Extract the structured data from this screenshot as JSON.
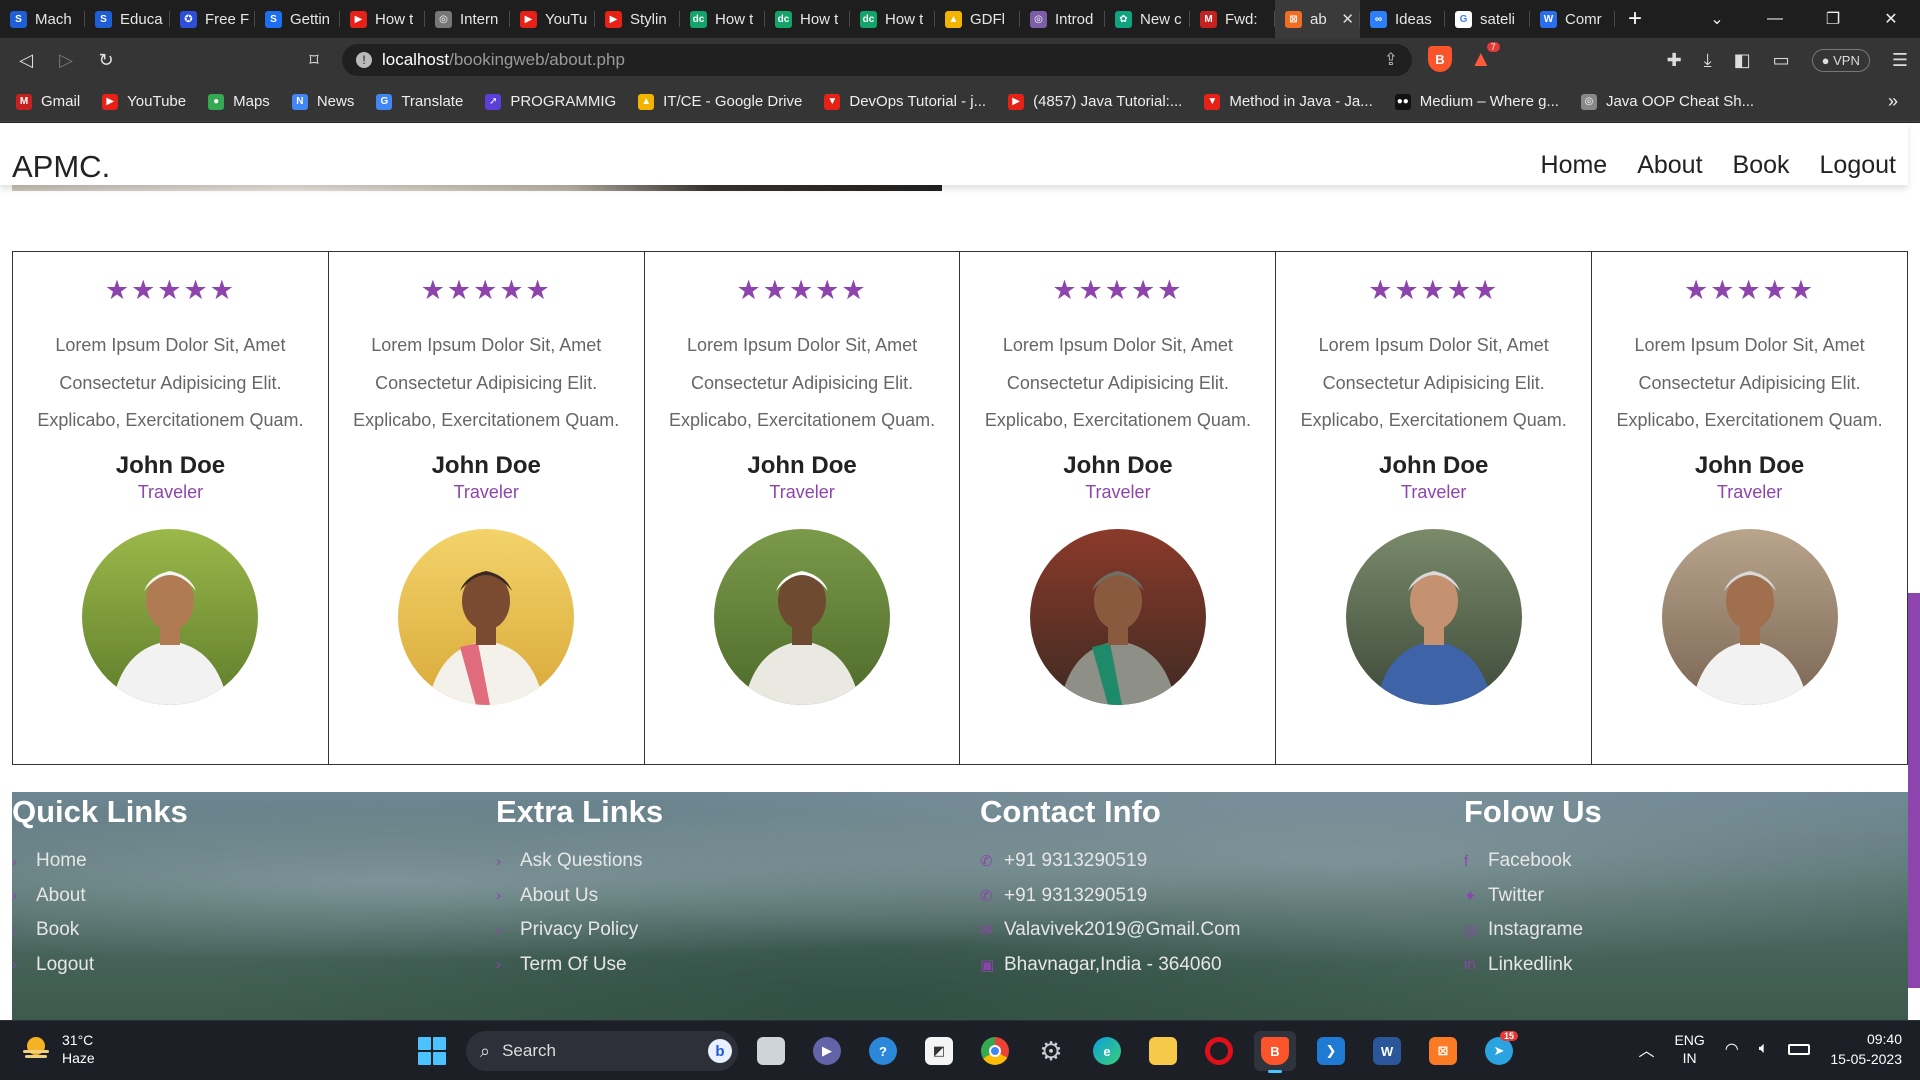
{
  "browser": {
    "tabs": [
      {
        "title": "Mach",
        "color": "#1f5fd6",
        "glyph": "S"
      },
      {
        "title": "Educa",
        "color": "#1f5fd6",
        "glyph": "S"
      },
      {
        "title": "Free F",
        "color": "#2b4fd9",
        "glyph": "✪"
      },
      {
        "title": "Gettin",
        "color": "#1e6ff0",
        "glyph": "S"
      },
      {
        "title": "How t",
        "color": "#e62117",
        "glyph": "▶"
      },
      {
        "title": "Intern",
        "color": "#777777",
        "glyph": "◎"
      },
      {
        "title": "YouTu",
        "color": "#e62117",
        "glyph": "▶"
      },
      {
        "title": "Stylin",
        "color": "#e62117",
        "glyph": "▶"
      },
      {
        "title": "How t",
        "color": "#13a36b",
        "glyph": "dc"
      },
      {
        "title": "How t",
        "color": "#13a36b",
        "glyph": "dc"
      },
      {
        "title": "How t",
        "color": "#13a36b",
        "glyph": "dc"
      },
      {
        "title": "GDFl",
        "color": "#f3b400",
        "glyph": "▲"
      },
      {
        "title": "Introd",
        "color": "#7b5ea7",
        "glyph": "◎"
      },
      {
        "title": "New c",
        "color": "#10a37f",
        "glyph": "✿"
      },
      {
        "title": "Fwd: ",
        "color": "#c5221f",
        "glyph": "M"
      },
      {
        "title": "ab",
        "color": "#f06d21",
        "glyph": "⊠",
        "active": true
      },
      {
        "title": "Ideas",
        "color": "#2d7ff9",
        "glyph": "∞"
      },
      {
        "title": "sateli",
        "color": "#ffffff",
        "glyph": "G"
      },
      {
        "title": "Comr",
        "color": "#2a6ef0",
        "glyph": "W"
      }
    ],
    "new_tab": "+",
    "url_host": "localhost",
    "url_path": "/bookingweb/about.php",
    "vpn_label": "VPN",
    "brave_badge": "7",
    "bookmarks": [
      {
        "label": "Gmail",
        "color": "#c5221f",
        "glyph": "M"
      },
      {
        "label": "YouTube",
        "color": "#e62117",
        "glyph": "▶"
      },
      {
        "label": "Maps",
        "color": "#34a853",
        "glyph": "●"
      },
      {
        "label": "News",
        "color": "#4285f4",
        "glyph": "N"
      },
      {
        "label": "Translate",
        "color": "#4285f4",
        "glyph": "G"
      },
      {
        "label": "PROGRAMMIG",
        "color": "#5b3fd8",
        "glyph": "➚"
      },
      {
        "label": "IT/CE - Google Drive",
        "color": "#f3b400",
        "glyph": "▲"
      },
      {
        "label": "DevOps Tutorial - j...",
        "color": "#e62117",
        "glyph": "▼"
      },
      {
        "label": "(4857) Java Tutorial:...",
        "color": "#e62117",
        "glyph": "▶"
      },
      {
        "label": "Method in Java - Ja...",
        "color": "#e62117",
        "glyph": "▼"
      },
      {
        "label": "Medium – Where g...",
        "color": "#111111",
        "glyph": "●●"
      },
      {
        "label": "Java OOP Cheat Sh...",
        "color": "#888888",
        "glyph": "◎"
      }
    ],
    "bookmarks_more": "»"
  },
  "site": {
    "logo": "APMC.",
    "nav": [
      "Home",
      "About",
      "Book",
      "Logout"
    ]
  },
  "reviews": [
    {
      "stars": "★★★★★",
      "text": "Lorem Ipsum Dolor Sit, Amet Consectetur Adipisicing Elit. Explicabo, Exercitationem Quam.",
      "name": "John Doe",
      "role": "Traveler"
    },
    {
      "stars": "★★★★★",
      "text": "Lorem Ipsum Dolor Sit, Amet Consectetur Adipisicing Elit. Explicabo, Exercitationem Quam.",
      "name": "John Doe",
      "role": "Traveler"
    },
    {
      "stars": "★★★★★",
      "text": "Lorem Ipsum Dolor Sit, Amet Consectetur Adipisicing Elit. Explicabo, Exercitationem Quam.",
      "name": "John Doe",
      "role": "Traveler"
    },
    {
      "stars": "★★★★★",
      "text": "Lorem Ipsum Dolor Sit, Amet Consectetur Adipisicing Elit. Explicabo, Exercitationem Quam.",
      "name": "John Doe",
      "role": "Traveler"
    },
    {
      "stars": "★★★★★",
      "text": "Lorem Ipsum Dolor Sit, Amet Consectetur Adipisicing Elit. Explicabo, Exercitationem Quam.",
      "name": "John Doe",
      "role": "Traveler"
    },
    {
      "stars": "★★★★★",
      "text": "Lorem Ipsum Dolor Sit, Amet Consectetur Adipisicing Elit. Explicabo, Exercitationem Quam.",
      "name": "John Doe",
      "role": "Traveler"
    }
  ],
  "footer": {
    "quick_links": {
      "title": "Quick Links",
      "items": [
        "Home",
        "About",
        "Book",
        "Logout"
      ]
    },
    "extra_links": {
      "title": "Extra Links",
      "items": [
        "Ask Questions",
        "About Us",
        "Privacy Policy",
        "Term Of Use"
      ]
    },
    "contact": {
      "title": "Contact Info",
      "items": [
        "+91 9313290519",
        "+91 9313290519",
        "Valavivek2019@Gmail.Com",
        "Bhavnagar,India - 364060"
      ]
    },
    "follow": {
      "title": "Folow Us",
      "items": [
        "Facebook",
        "Twitter",
        "Instagrame",
        "Linkedlink"
      ]
    }
  },
  "taskbar": {
    "temp": "31°C",
    "weather": "Haze",
    "search_placeholder": "Search",
    "lang_line1": "ENG",
    "lang_line2": "IN",
    "time": "09:40",
    "date": "15-05-2023",
    "telegram_badge": "15"
  },
  "colors": {
    "accent": "#8e44ad"
  }
}
